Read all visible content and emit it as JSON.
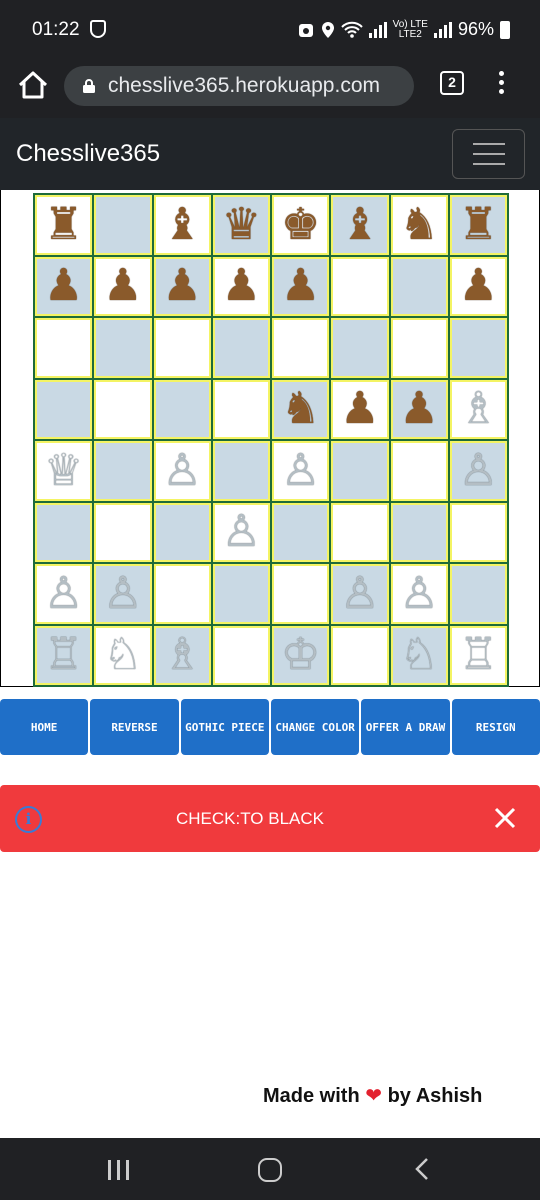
{
  "status_bar": {
    "time": "01:22",
    "signal_top": "Vo) LTE",
    "signal_bottom": "LTE2",
    "battery": "96%"
  },
  "browser": {
    "url": "chesslive365.herokuapp.com",
    "tab_count": "2"
  },
  "navbar": {
    "brand": "Chesslive365"
  },
  "board": {
    "squares": [
      [
        "♜",
        "",
        "♝",
        "♛",
        "♚",
        "♝",
        "♞",
        "♜"
      ],
      [
        "♟",
        "♟",
        "♟",
        "♟",
        "♟",
        "",
        "",
        "♟"
      ],
      [
        "",
        "",
        "",
        "",
        "",
        "",
        "",
        ""
      ],
      [
        "",
        "",
        "",
        "",
        "♞",
        "♟",
        "♟",
        "♗"
      ],
      [
        "♕",
        "",
        "♙",
        "",
        "♙",
        "",
        "",
        "♙"
      ],
      [
        "",
        "",
        "",
        "♙",
        "",
        "",
        "",
        ""
      ],
      [
        "♙",
        "♙",
        "",
        "",
        "",
        "♙",
        "♙",
        ""
      ],
      [
        "♖",
        "♘",
        "♗",
        "",
        "♔",
        "",
        "♘",
        "♖"
      ]
    ],
    "colors": {
      "light": "#ffffff",
      "dark": "#c9d9e4",
      "grid": "#1e6b3a",
      "highlight": "#f4f463"
    }
  },
  "actions": {
    "home": "HOME",
    "reverse": "REVERSE",
    "gothic_piece": "GOTHIC PIECE",
    "change_color": "CHANGE COLOR",
    "offer_draw": "OFFER A DRAW",
    "resign": "RESIGN"
  },
  "alert": {
    "message": "CHECK:TO BLACK",
    "color": "#f03a3d"
  },
  "footer": {
    "made_with": "Made with",
    "heart": "❤",
    "by": "by Ashish"
  }
}
